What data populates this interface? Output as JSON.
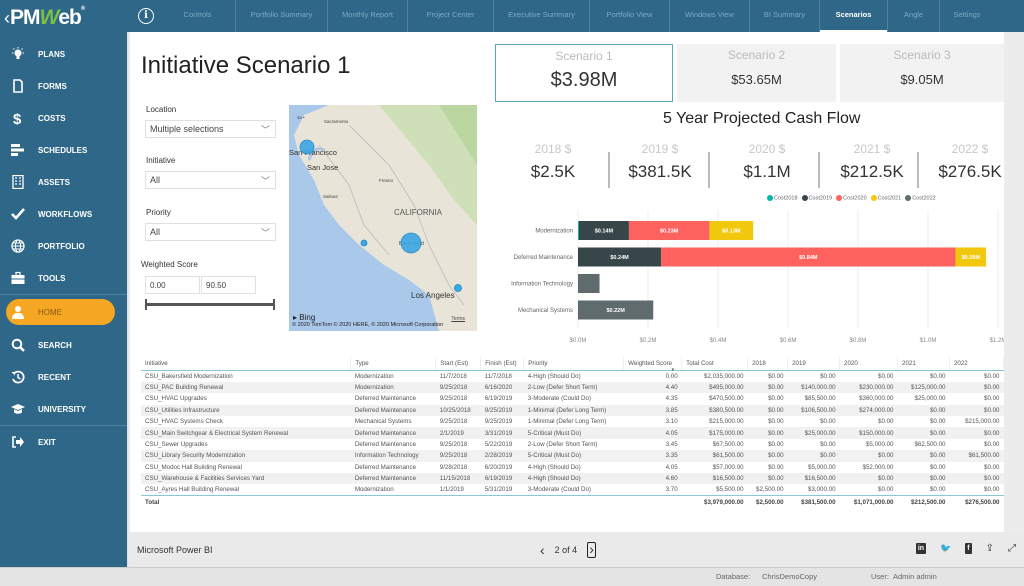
{
  "app": {
    "logo_text_left": "PM",
    "logo_text_w": "W",
    "logo_text_right": "eb",
    "logo_reg": "®",
    "back_glyph": "‹",
    "info_glyph": "i"
  },
  "tabs": [
    {
      "label": "Controls",
      "active": false
    },
    {
      "label": "Portfolio Summary",
      "active": false
    },
    {
      "label": "Monthly Report",
      "active": false
    },
    {
      "label": "Project Center",
      "active": false
    },
    {
      "label": "Executive Summary",
      "active": false
    },
    {
      "label": "Portfolio View",
      "active": false
    },
    {
      "label": "Windows View",
      "active": false
    },
    {
      "label": "BI Summary",
      "active": false
    },
    {
      "label": "Scenarios",
      "active": true
    },
    {
      "label": "Angle",
      "active": false
    },
    {
      "label": "Settings",
      "active": false
    }
  ],
  "sidebar": {
    "items": [
      {
        "label": "PLANS",
        "icon": "lightbulb-icon",
        "glyph": "💡"
      },
      {
        "label": "FORMS",
        "icon": "document-icon",
        "glyph": "▯"
      },
      {
        "label": "COSTS",
        "icon": "dollar-icon",
        "glyph": "$"
      },
      {
        "label": "SCHEDULES",
        "icon": "gantt-icon",
        "glyph": "☰"
      },
      {
        "label": "ASSETS",
        "icon": "building-icon",
        "glyph": "▦"
      },
      {
        "label": "WORKFLOWS",
        "icon": "checkmark-icon",
        "glyph": "✔"
      },
      {
        "label": "PORTFOLIO",
        "icon": "globe-icon",
        "glyph": "◍"
      },
      {
        "label": "TOOLS",
        "icon": "toolbox-icon",
        "glyph": "▬"
      }
    ],
    "home": {
      "label": "HOME",
      "icon": "user-icon",
      "glyph": "●"
    },
    "lower_items": [
      {
        "label": "SEARCH",
        "icon": "search-icon",
        "glyph": "⚲"
      },
      {
        "label": "RECENT",
        "icon": "history-icon",
        "glyph": "↺"
      },
      {
        "label": "UNIVERSITY",
        "icon": "graduation-cap-icon",
        "glyph": "🎓"
      }
    ],
    "exit": {
      "label": "EXIT",
      "icon": "exit-icon",
      "glyph": "➜"
    }
  },
  "report": {
    "title": "Initiative Scenario 1",
    "filters": {
      "location": {
        "label": "Location",
        "value": "Multiple selections"
      },
      "initiative": {
        "label": "Initiative",
        "value": "All"
      },
      "priority": {
        "label": "Priority",
        "value": "All"
      },
      "weighted_score": {
        "label": "Weighted Score",
        "min": "0.00",
        "max": "90.50"
      }
    },
    "map": {
      "labels": [
        "Sacramento",
        "San Francisco",
        "San Jose",
        "Fresno",
        "Salinas",
        "CALIFORNIA",
        "Bakersfield",
        "Los Angeles"
      ],
      "bing": "Bing",
      "attribution": "© 2020 TomTom © 2020 HERE, © 2020 Microsoft Corporation",
      "terms": "Terms"
    },
    "scenarios": [
      {
        "label": "Scenario 1",
        "value": "$3.98M",
        "selected": true
      },
      {
        "label": "Scenario 2",
        "value": "$53.65M",
        "selected": false
      },
      {
        "label": "Scenario 3",
        "value": "$9.05M",
        "selected": false
      }
    ],
    "cashflow_title": "5 Year Projected Cash Flow",
    "kpis": [
      {
        "label": "2018 $",
        "value": "$2.5K"
      },
      {
        "label": "2019 $",
        "value": "$381.5K"
      },
      {
        "label": "2020 $",
        "value": "$1.1M"
      },
      {
        "label": "2021 $",
        "value": "$212.5K"
      },
      {
        "label": "2022 $",
        "value": "$276.5K"
      }
    ]
  },
  "chart_data": {
    "type": "bar",
    "orientation": "horizontal-stacked",
    "title": "",
    "xlabel": "",
    "ylabel": "",
    "xlim": [
      0,
      1.2
    ],
    "x_ticks": [
      "$0.0M",
      "$0.2M",
      "$0.4M",
      "$0.6M",
      "$0.8M",
      "$1.0M",
      "$1.2M"
    ],
    "grid": true,
    "legend_position": "top",
    "categories": [
      "Modernization",
      "Deferred Maintenance",
      "Information Technology",
      "Mechanical Systems"
    ],
    "series": [
      {
        "name": "Cost2018",
        "color": "#01b8aa",
        "values": [
          0.0025,
          0,
          0,
          0
        ],
        "labels": [
          "",
          "",
          "",
          ""
        ]
      },
      {
        "name": "Cost2019",
        "color": "#374649",
        "values": [
          0.143,
          0.2375,
          0,
          0
        ],
        "labels": [
          "$0.14M",
          "$0.24M",
          "",
          ""
        ]
      },
      {
        "name": "Cost2020",
        "color": "#fd625e",
        "values": [
          0.23,
          0.841,
          0,
          0
        ],
        "labels": [
          "$0.23M",
          "$0.84M",
          "",
          ""
        ]
      },
      {
        "name": "Cost2021",
        "color": "#f2c80f",
        "values": [
          0.125,
          0.0875,
          0,
          0
        ],
        "labels": [
          "$0.13M",
          "$0.09M",
          "",
          ""
        ]
      },
      {
        "name": "Cost2022",
        "color": "#5f6b6d",
        "values": [
          0,
          0,
          0.0615,
          0.215
        ],
        "labels": [
          "",
          "",
          "",
          "$0.22M"
        ]
      }
    ]
  },
  "table": {
    "columns": [
      "Initiative",
      "Type",
      "Start (Est)",
      "Finish (Est)",
      "Priority",
      "Weighted Score",
      "Total Cost",
      "2018",
      "2019",
      "2020",
      "2021",
      "2022"
    ],
    "sort_indicator": "▾",
    "rows": [
      [
        "CSU_Bakersfield Modernization",
        "Modernization",
        "11/7/2018",
        "11/7/2018",
        "4-High (Should Do)",
        "0.00",
        "$2,035,000.00",
        "$0.00",
        "$0.00",
        "$0.00",
        "$0.00",
        "$0.00"
      ],
      [
        "CSU_PAC Building Renewal",
        "Modernization",
        "9/25/2018",
        "6/16/2020",
        "2-Low (Defer Short Term)",
        "4.40",
        "$495,000.00",
        "$0.00",
        "$140,000.00",
        "$230,000.00",
        "$125,000.00",
        "$0.00"
      ],
      [
        "CSU_HVAC Upgrades",
        "Deferred Maintenance",
        "9/25/2018",
        "6/19/2019",
        "3-Moderate (Could Do)",
        "4.35",
        "$470,500.00",
        "$0.00",
        "$85,500.00",
        "$360,000.00",
        "$25,000.00",
        "$0.00"
      ],
      [
        "CSU_Utilities Infrastructure",
        "Deferred Maintenance",
        "10/25/2018",
        "9/25/2019",
        "1-Minimal (Defer Long Term)",
        "3.85",
        "$380,500.00",
        "$0.00",
        "$106,500.00",
        "$274,000.00",
        "$0.00",
        "$0.00"
      ],
      [
        "CSU_HVAC Systems Check",
        "Mechanical Systems",
        "9/25/2018",
        "9/25/2019",
        "1-Minimal (Defer Long Term)",
        "3.10",
        "$215,000.00",
        "$0.00",
        "$0.00",
        "$0.00",
        "$0.00",
        "$215,000.00"
      ],
      [
        "CSU_Main Switchgear & Electrical System Renewal",
        "Deferred Maintenance",
        "2/1/2019",
        "3/31/2019",
        "5-Critical (Must Do)",
        "4.05",
        "$175,000.00",
        "$0.00",
        "$25,000.00",
        "$150,000.00",
        "$0.00",
        "$0.00"
      ],
      [
        "CSU_Sewer Upgrades",
        "Deferred Maintenance",
        "9/25/2018",
        "5/22/2019",
        "2-Low (Defer Short Term)",
        "3.45",
        "$67,500.00",
        "$0.00",
        "$0.00",
        "$5,000.00",
        "$62,500.00",
        "$0.00"
      ],
      [
        "CSU_Library Security Modernization",
        "Information Technology",
        "9/25/2018",
        "2/28/2019",
        "5-Critical (Must Do)",
        "3.35",
        "$61,500.00",
        "$0.00",
        "$0.00",
        "$0.00",
        "$0.00",
        "$61,500.00"
      ],
      [
        "CSU_Modoc Hall Building Renewal",
        "Deferred Maintenance",
        "9/28/2018",
        "6/20/2019",
        "4-High (Should Do)",
        "4.05",
        "$57,000.00",
        "$0.00",
        "$5,000.00",
        "$52,000.00",
        "$0.00",
        "$0.00"
      ],
      [
        "CSU_Warehouse & Facilities Services Yard",
        "Deferred Maintenance",
        "11/15/2018",
        "6/19/2019",
        "4-High (Should Do)",
        "4.60",
        "$16,500.00",
        "$0.00",
        "$16,500.00",
        "$0.00",
        "$0.00",
        "$0.00"
      ],
      [
        "CSU_Ayres Hall Building Renewal",
        "Modernization",
        "1/1/2019",
        "5/31/2019",
        "3-Moderate (Could Do)",
        "3.70",
        "$5,500.00",
        "$2,500.00",
        "$3,000.00",
        "$0.00",
        "$0.00",
        "$0.00"
      ]
    ],
    "total": [
      "Total",
      "",
      "",
      "",
      "",
      "",
      "$3,979,000.00",
      "$2,500.00",
      "$381,500.00",
      "$1,071,000.00",
      "$212,500.00",
      "$276,500.00"
    ]
  },
  "powerbi": {
    "label": "Microsoft Power BI",
    "page": "2 of 4",
    "prev": "‹",
    "next": "›",
    "share_icons": [
      {
        "name": "linkedin-icon",
        "glyph": "in"
      },
      {
        "name": "twitter-icon",
        "glyph": "🐦"
      },
      {
        "name": "facebook-icon",
        "glyph": "f"
      },
      {
        "name": "share-icon",
        "glyph": "⇪"
      },
      {
        "name": "fullscreen-icon",
        "glyph": "⤢"
      }
    ]
  },
  "status": {
    "database_label": "Database:",
    "database_value": "ChrisDemoCopy",
    "user_label": "User:",
    "user_value": "Admin admin"
  }
}
